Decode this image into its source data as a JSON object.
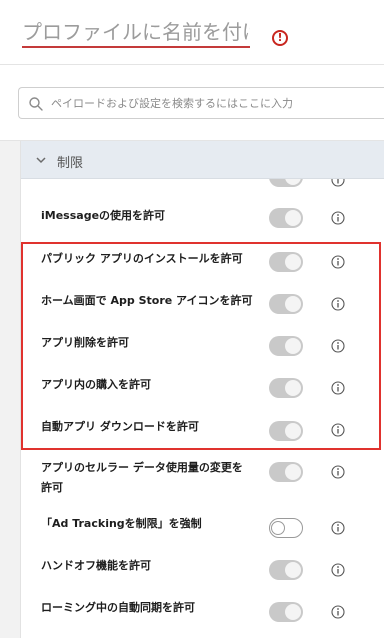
{
  "header": {
    "profile_name_placeholder": "プロファイルに名前を付けてください"
  },
  "search": {
    "placeholder": "ペイロードおよび設定を検索するにはここに入力"
  },
  "section": {
    "title": "制限"
  },
  "rows": [
    {
      "label": "iMessageの使用を許可",
      "enabled": true
    },
    {
      "label": "パブリック アプリのインストールを許可",
      "enabled": true
    },
    {
      "label": "ホーム画面で App Store アイコンを許可",
      "enabled": true
    },
    {
      "label": "アプリ削除を許可",
      "enabled": true
    },
    {
      "label": "アプリ内の購入を許可",
      "enabled": true
    },
    {
      "label": "自動アプリ ダウンロードを許可",
      "enabled": true
    },
    {
      "label_line1": "アプリのセルラー データ使用量の変更を",
      "label_line2": "許可",
      "enabled": true
    },
    {
      "label": "「Ad Trackingを制限」を強制",
      "enabled": false
    },
    {
      "label": "ハンドオフ機能を許可",
      "enabled": true
    },
    {
      "label": "ローミング中の自動同期を許可",
      "enabled": true
    }
  ],
  "colors": {
    "highlight": "#e0322e",
    "error": "#c8261f",
    "section_bg": "#e6ebf1"
  }
}
